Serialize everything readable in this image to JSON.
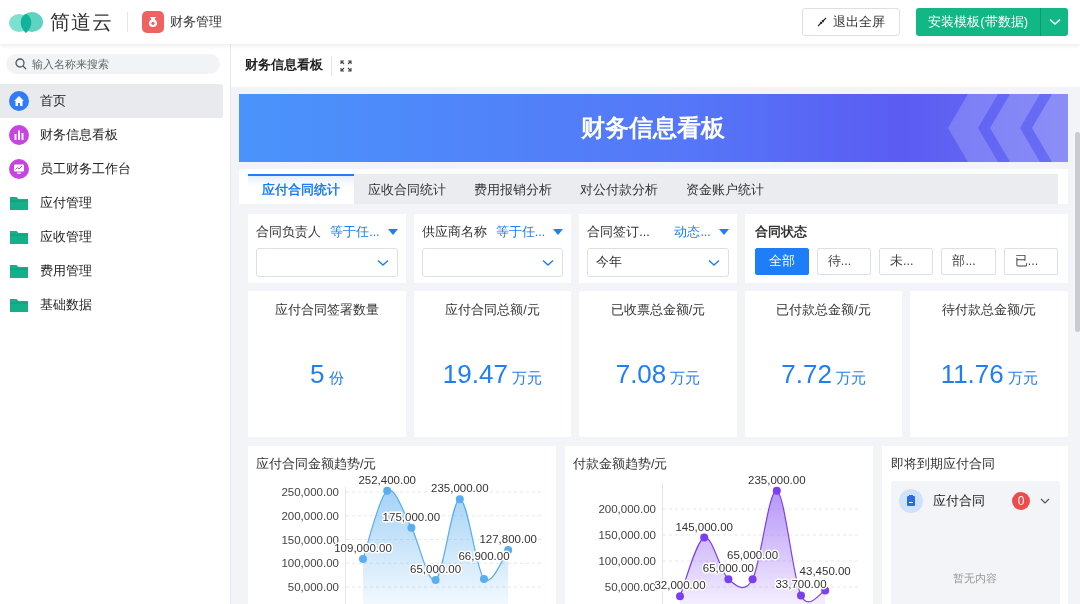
{
  "header": {
    "brand": "简道云",
    "app_name": "财务管理",
    "exit_button": "退出全屏",
    "install_button": "安装模板(带数据)"
  },
  "sidebar": {
    "search": {
      "placeholder": "输入名称来搜索"
    },
    "items": [
      {
        "label": "首页",
        "kind": "home",
        "selected": true
      },
      {
        "label": "财务信息看板",
        "kind": "chart",
        "selected": false
      },
      {
        "label": "员工财务工作台",
        "kind": "screen",
        "selected": false
      },
      {
        "label": "应付管理",
        "kind": "folder",
        "selected": false
      },
      {
        "label": "应收管理",
        "kind": "folder",
        "selected": false
      },
      {
        "label": "费用管理",
        "kind": "folder",
        "selected": false
      },
      {
        "label": "基础数据",
        "kind": "folder",
        "selected": false
      }
    ]
  },
  "page": {
    "title": "财务信息看板",
    "banner": {
      "title": "财务信息看板"
    },
    "tabs": [
      {
        "label": "应付合同统计",
        "selected": true
      },
      {
        "label": "应收合同统计",
        "selected": false
      },
      {
        "label": "费用报销分析",
        "selected": false
      },
      {
        "label": "对公付款分析",
        "selected": false
      },
      {
        "label": "资金账户统计",
        "selected": false
      }
    ],
    "filters": [
      {
        "label": "合同负责人",
        "operator": "等于任..."
      },
      {
        "label": "供应商名称",
        "operator": "等于任..."
      },
      {
        "label": "合同签订...",
        "operator": "动态...",
        "value": "今年"
      }
    ],
    "status_filter": {
      "label": "合同状态",
      "options": [
        {
          "label": "全部",
          "selected": true
        },
        {
          "label": "待...",
          "selected": false
        },
        {
          "label": "未...",
          "selected": false
        },
        {
          "label": "部...",
          "selected": false
        },
        {
          "label": "已...",
          "selected": false
        }
      ]
    },
    "kpis": [
      {
        "title": "应付合同签署数量",
        "value": "5",
        "unit": "份"
      },
      {
        "title": "应付合同总额/元",
        "value": "19.47",
        "unit": "万元"
      },
      {
        "title": "已收票总金额/元",
        "value": "7.08",
        "unit": "万元"
      },
      {
        "title": "已付款总金额/元",
        "value": "7.72",
        "unit": "万元"
      },
      {
        "title": "待付款总金额/元",
        "value": "11.76",
        "unit": "万元"
      }
    ],
    "charts": [
      {
        "title": "应付合同金额趋势/元",
        "chart_data": {
          "type": "area",
          "grid": true,
          "ylim": [
            0,
            260000
          ],
          "series": [
            {
              "color": "#5aaef0",
              "values": [
                109000,
                252400,
                175000,
                65000,
                235000,
                66900,
                127800
              ]
            }
          ],
          "yticks": [
            {
              "value": 50000,
              "label": "50,000.00"
            },
            {
              "value": 100000,
              "label": "100,000.00"
            },
            {
              "value": 150000,
              "label": "150,000.00"
            },
            {
              "value": 200000,
              "label": "200,000.00"
            },
            {
              "value": 250000,
              "label": "250,000.00"
            }
          ],
          "value_labels": [
            "109,000.00",
            "252,400.00",
            "175,000.00",
            "65,000.00",
            "235,000.00",
            "66,900.00",
            "127,800.00"
          ]
        }
      },
      {
        "title": "付款金额趋势/元",
        "chart_data": {
          "type": "area",
          "grid": true,
          "ylim": [
            0,
            250000
          ],
          "series": [
            {
              "color": "#7b3ff2",
              "values": [
                32000,
                145000,
                65000,
                65000,
                235000,
                33700,
                43450
              ]
            }
          ],
          "yticks": [
            {
              "value": 50000,
              "label": "50,000.00"
            },
            {
              "value": 100000,
              "label": "100,000.00"
            },
            {
              "value": 150000,
              "label": "150,000.00"
            },
            {
              "value": 200000,
              "label": "200,000.00"
            }
          ],
          "value_labels": [
            "32,000.00",
            "145,000.00",
            "65,000.00",
            "65,000.00",
            "235,000.00",
            "33,700.00",
            "43,450.00"
          ]
        }
      }
    ],
    "expiring": {
      "title": "即将到期应付合同",
      "group": "应付合同",
      "count": "0",
      "empty_text": "暂无内容"
    }
  }
}
